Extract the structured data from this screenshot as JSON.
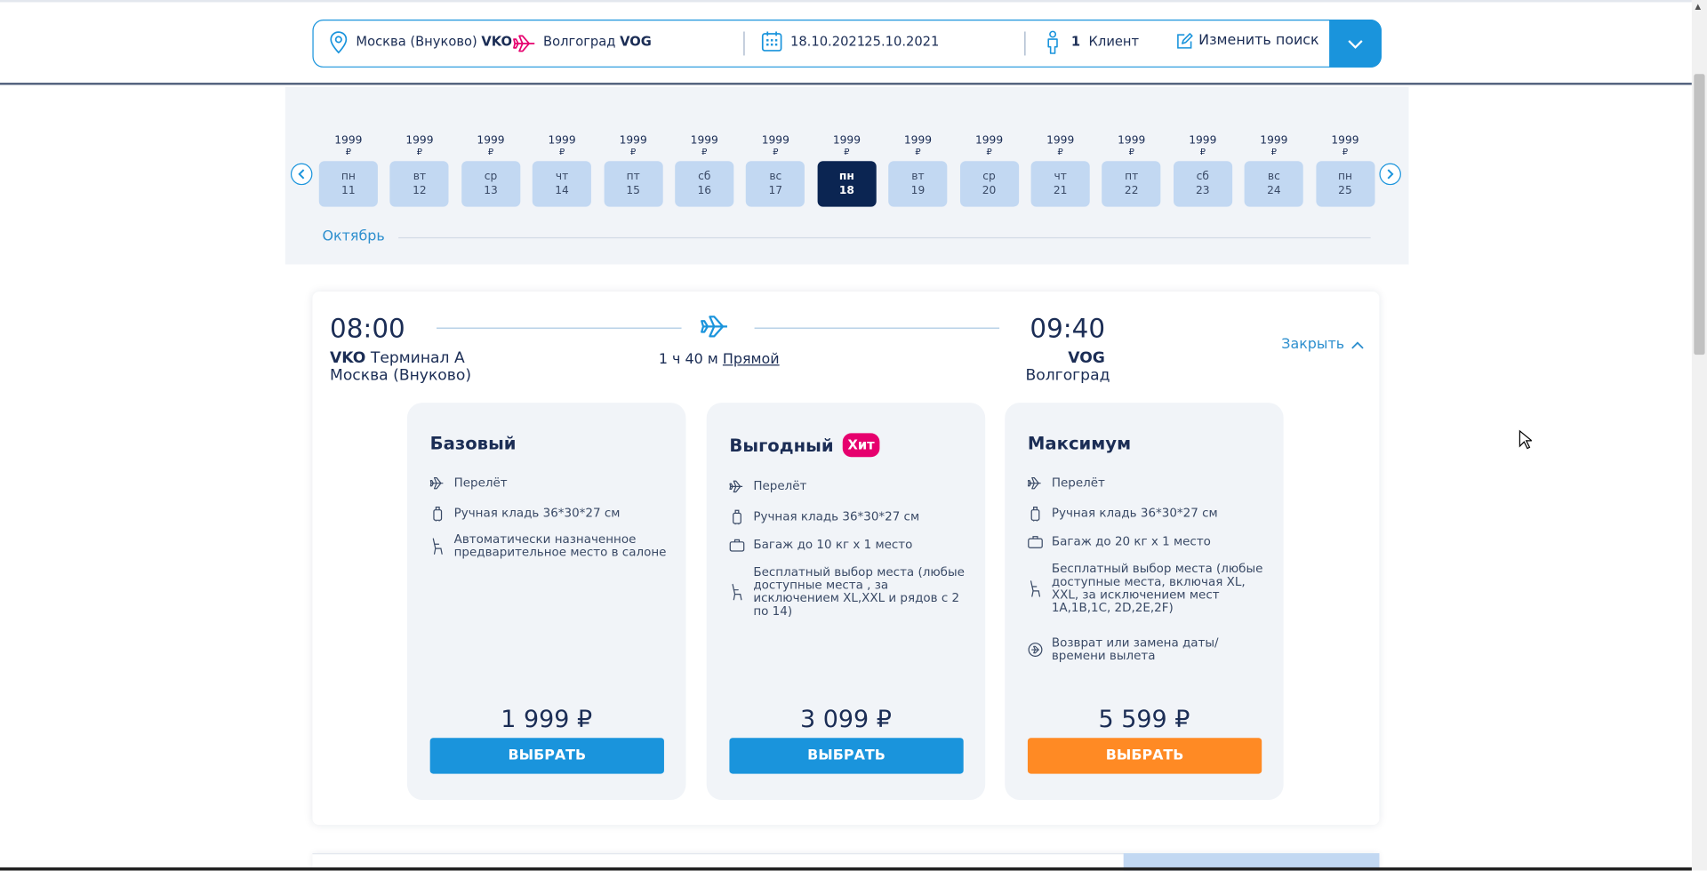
{
  "search": {
    "from_city": "Москва (Внуково)",
    "from_code": "VKO",
    "to_city": "Волгоград",
    "to_code": "VOG",
    "date_from": "18.10.2021",
    "date_to": "25.10.2021",
    "passengers_count": "1",
    "passengers_label": "Клиент",
    "edit_label": "Изменить поиск"
  },
  "calendar": {
    "month": "Октябрь",
    "currency": "₽",
    "days": [
      {
        "weekday": "пн",
        "day": "11",
        "price": "1999"
      },
      {
        "weekday": "вт",
        "day": "12",
        "price": "1999"
      },
      {
        "weekday": "ср",
        "day": "13",
        "price": "1999"
      },
      {
        "weekday": "чт",
        "day": "14",
        "price": "1999"
      },
      {
        "weekday": "пт",
        "day": "15",
        "price": "1999"
      },
      {
        "weekday": "сб",
        "day": "16",
        "price": "1999"
      },
      {
        "weekday": "вс",
        "day": "17",
        "price": "1999"
      },
      {
        "weekday": "пн",
        "day": "18",
        "price": "1999",
        "active": true
      },
      {
        "weekday": "вт",
        "day": "19",
        "price": "1999"
      },
      {
        "weekday": "ср",
        "day": "20",
        "price": "1999"
      },
      {
        "weekday": "чт",
        "day": "21",
        "price": "1999"
      },
      {
        "weekday": "пт",
        "day": "22",
        "price": "1999"
      },
      {
        "weekday": "сб",
        "day": "23",
        "price": "1999"
      },
      {
        "weekday": "вс",
        "day": "24",
        "price": "1999"
      },
      {
        "weekday": "пн",
        "day": "25",
        "price": "1999"
      }
    ]
  },
  "flight": {
    "depart_time": "08:00",
    "arrive_time": "09:40",
    "depart_code": "VKO",
    "depart_terminal": "Терминал А",
    "depart_city": "Москва (Внуково)",
    "arrive_code": "VOG",
    "arrive_city": "Волгоград",
    "duration": "1 ч 40 м",
    "type": "Прямой",
    "close_label": "Закрыть"
  },
  "tariffs": [
    {
      "name": "Базовый",
      "badge": "",
      "features": [
        {
          "icon": "plane",
          "text": "Перелёт"
        },
        {
          "icon": "cabin-bag",
          "text": "Ручная кладь 36*30*27 см"
        },
        {
          "icon": "seat",
          "text": "Автоматически назначенное предварительное место в салоне"
        }
      ],
      "price": "1 999 ₽",
      "button": "ВЫБРАТЬ"
    },
    {
      "name": "Выгодный",
      "badge": "Хит",
      "features": [
        {
          "icon": "plane",
          "text": "Перелёт"
        },
        {
          "icon": "cabin-bag",
          "text": "Ручная кладь 36*30*27 см"
        },
        {
          "icon": "suitcase",
          "text": "Багаж до 10 кг x 1 место"
        },
        {
          "icon": "seat",
          "text": "Бесплатный выбор места (любые доступные места , за исключением XL,XXL и рядов с 2 по 14)"
        }
      ],
      "price": "3 099 ₽",
      "button": "ВЫБРАТЬ"
    },
    {
      "name": "Максимум",
      "badge": "",
      "features": [
        {
          "icon": "plane",
          "text": "Перелёт"
        },
        {
          "icon": "cabin-bag",
          "text": "Ручная кладь 36*30*27 см"
        },
        {
          "icon": "suitcase",
          "text": "Багаж до 20 кг x 1 место"
        },
        {
          "icon": "seat",
          "text": "Бесплатный выбор места (любые доступные места, включая XL, XXL, за исключением мест 1A,1B,1C, 2D,2E,2F)"
        },
        {
          "icon": "refund",
          "text": "Возврат или замена даты/времени вылета"
        }
      ],
      "price": "5 599 ₽",
      "button": "ВЫБРАТЬ"
    }
  ],
  "colors": {
    "primary": "#1a94dc",
    "accent": "#ff8a24",
    "navy": "#0b2552",
    "hit": "#e6006e"
  }
}
